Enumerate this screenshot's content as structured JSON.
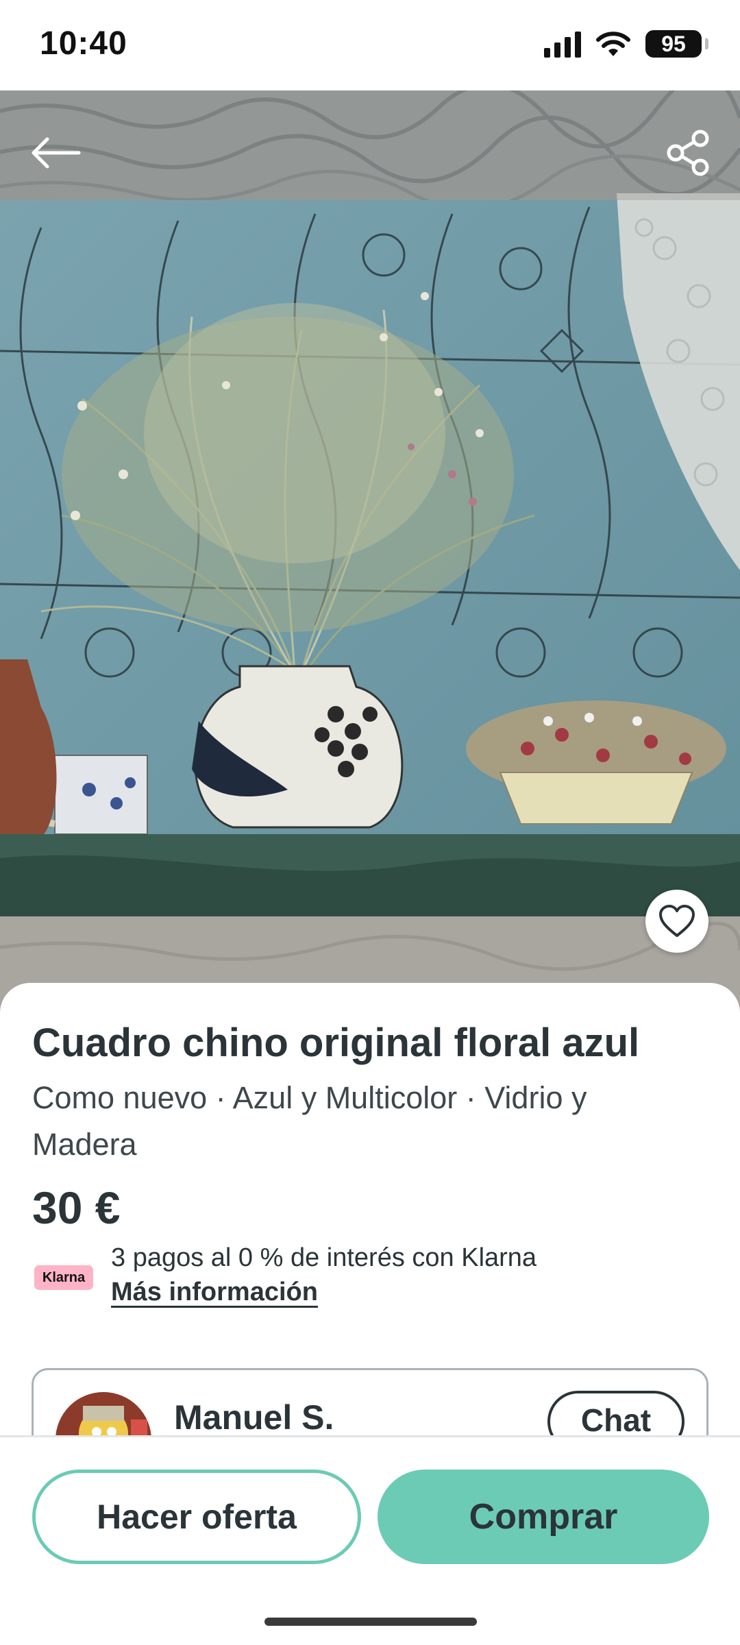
{
  "status_bar": {
    "time": "10:40",
    "battery": "95"
  },
  "listing": {
    "title": "Cuadro chino original floral azul",
    "subtitle": "Como nuevo · Azul y Multicolor · Vidrio y Madera",
    "price": "30 €",
    "klarna": {
      "badge": "Klarna",
      "text": "3 pagos al 0 % de interés con Klarna",
      "link": "Más información"
    }
  },
  "seller": {
    "name": "Manuel S.",
    "chat_label": "Chat"
  },
  "actions": {
    "offer_label": "Hacer oferta",
    "buy_label": "Comprar"
  },
  "colors": {
    "accent": "#6ccbb5",
    "text": "#2b3438",
    "klarna": "#ffb3c7"
  },
  "icons": {
    "back": "arrow-left-icon",
    "share": "share-icon",
    "favorite": "heart-icon"
  }
}
